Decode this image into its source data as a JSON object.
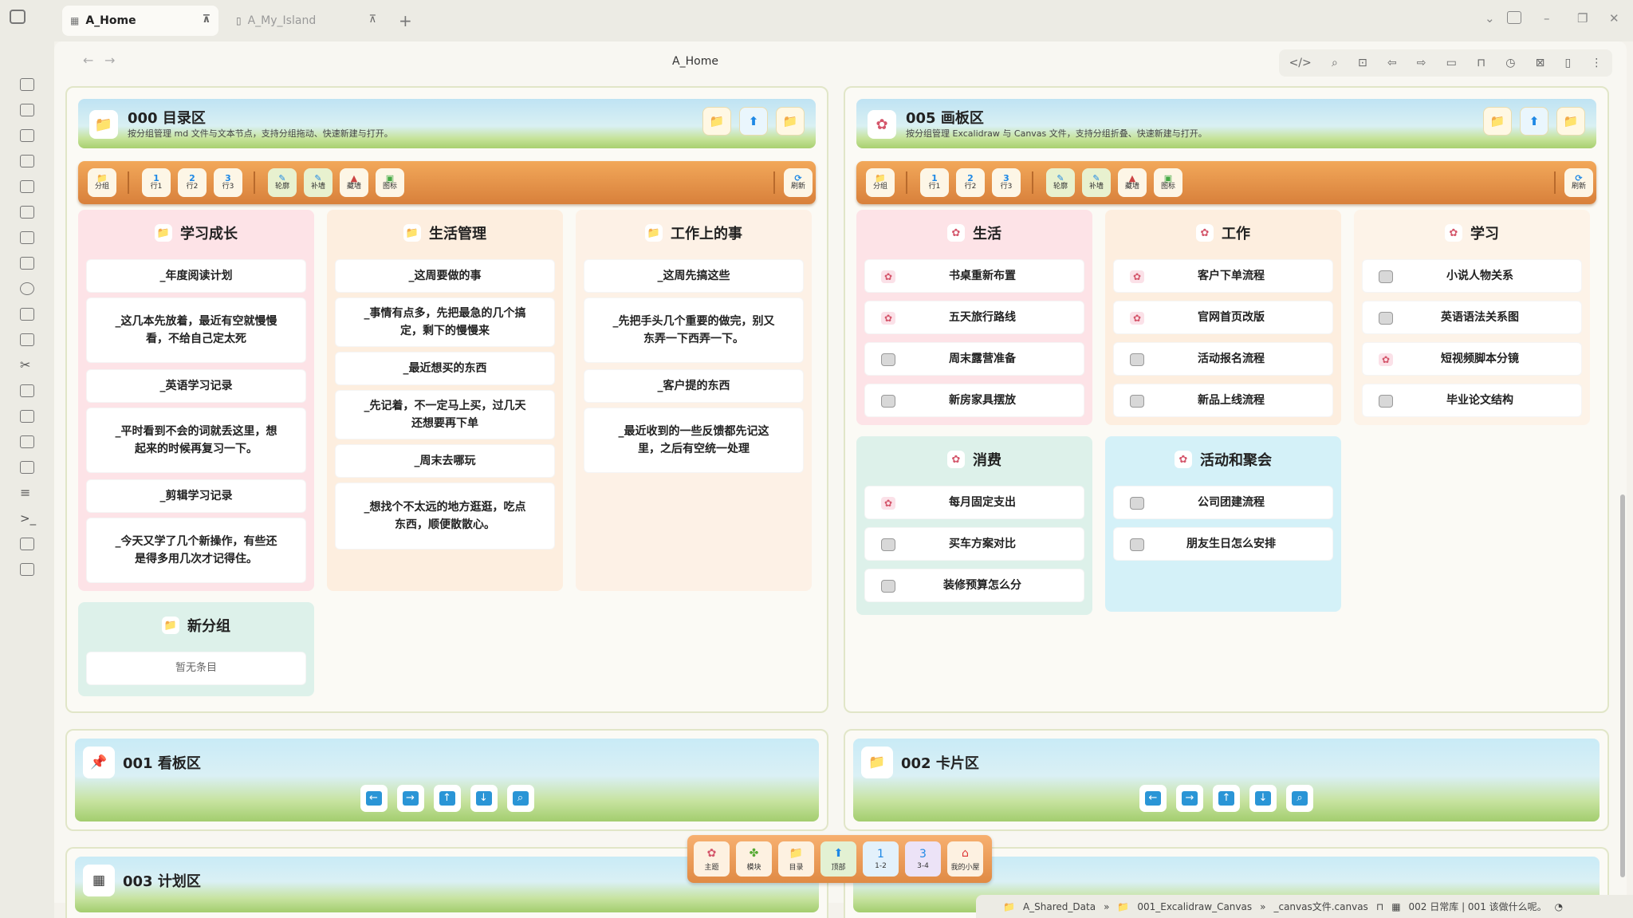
{
  "tabs": [
    {
      "label": "A_Home",
      "active": true
    },
    {
      "label": "A_My_Island",
      "active": false
    }
  ],
  "nav": {
    "title": "A_Home"
  },
  "panels": {
    "catalog": {
      "title": "000 目录区",
      "subtitle": "按分组管理 md 文件与文本节点，支持分组拖动、快速新建与打开。"
    },
    "canvas": {
      "title": "005 画板区",
      "subtitle": "按分组管理 Excalidraw 与 Canvas 文件，支持分组折叠、快速新建与打开。"
    },
    "kanban": {
      "title": "001 看板区"
    },
    "cards": {
      "title": "002 卡片区"
    },
    "plan": {
      "title": "003 计划区"
    }
  },
  "toolbar": {
    "group": "分组",
    "row1": "行1",
    "row2": "行2",
    "row3": "行3",
    "outline": "轮廓",
    "fill": "补墙",
    "hide": "藏墙",
    "icon": "图标",
    "refresh": "刷新"
  },
  "catalog_cols": [
    {
      "title": "学习成长",
      "items": [
        "_年度阅读计划",
        "_这几本先放着，最近有空就慢慢看，不给自己定太死",
        "_英语学习记录",
        "_平时看到不会的词就丢这里，想起来的时候再复习一下。",
        "_剪辑学习记录",
        "_今天又学了几个新操作，有些还是得多用几次才记得住。"
      ]
    },
    {
      "title": "生活管理",
      "items": [
        "_这周要做的事",
        "_事情有点多，先把最急的几个搞定，剩下的慢慢来",
        "_最近想买的东西",
        "_先记着，不一定马上买，过几天还想要再下单",
        "_周末去哪玩",
        "_想找个不太远的地方逛逛，吃点东西，顺便散散心。"
      ]
    },
    {
      "title": "工作上的事",
      "items": [
        "_这周先搞这些",
        "_先把手头几个重要的做完，别又东弄一下西弄一下。",
        "_客户提的东西",
        "_最近收到的一些反馈都先记这里，之后有空统一处理"
      ]
    }
  ],
  "new_group": {
    "title": "新分组",
    "empty": "暂无条目"
  },
  "canvas_cols": [
    {
      "title": "生活",
      "items": [
        "书桌重新布置",
        "五天旅行路线",
        "周末露营准备",
        "新房家具摆放"
      ]
    },
    {
      "title": "工作",
      "items": [
        "客户下单流程",
        "官网首页改版",
        "活动报名流程",
        "新品上线流程"
      ]
    },
    {
      "title": "学习",
      "items": [
        "小说人物关系",
        "英语语法关系图",
        "短视频脚本分镜",
        "毕业论文结构"
      ]
    },
    {
      "title": "消费",
      "items": [
        "每月固定支出",
        "买车方案对比",
        "装修预算怎么分"
      ]
    },
    {
      "title": "活动和聚会",
      "items": [
        "公司团建流程",
        "朋友生日怎么安排"
      ]
    }
  ],
  "dock": [
    "主题",
    "模块",
    "目录",
    "顶部",
    "1-2",
    "3-4",
    "我的小屋"
  ],
  "status": {
    "path1": "A_Shared_Data",
    "path2": "001_Excalidraw_Canvas",
    "path3": "_canvas文件.canvas",
    "daily": "002 日常库 | 001 该做什么呢。"
  },
  "icons": [
    "sidebar-toggle-icon",
    "back-icon",
    "forward-icon",
    "code-icon",
    "search-icon",
    "bookmark-icon",
    "folder-icon",
    "palette-icon",
    "pin-icon",
    "calendar-icon",
    "arrow-up-icon"
  ]
}
